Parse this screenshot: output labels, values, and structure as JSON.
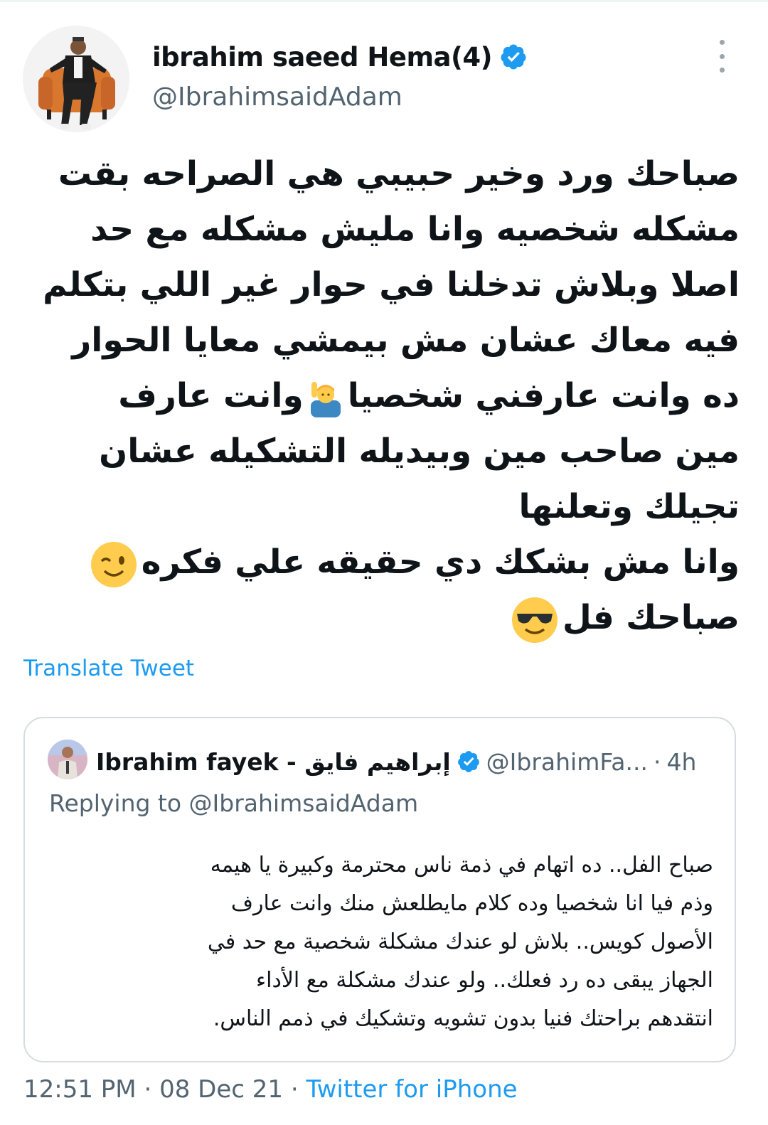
{
  "author": {
    "display_name": "ibrahim saeed Hema(4)",
    "handle": "@IbrahimsaidAdam",
    "verified": true,
    "avatar_icon": "user-avatar-photo"
  },
  "menu": {
    "icon": "more-vertical-icon"
  },
  "tweet": {
    "lines": [
      "صباحك ورد وخير حبيبي هي الصراحه بقت",
      "مشكله شخصيه وانا مليش مشكله مع حد",
      "اصلا وبلاش تدخلنا في حوار غير اللي بتكلم",
      "فيه معاك عشان مش بيمشي معايا الحوار",
      "ده وانت عارفني شخصيا",
      "وانت عارف",
      "مين صاحب مين وبيديله التشكيله عشان",
      "تجيلك وتعلنها",
      "وانا مش بشكك دي حقيقه علي فكره",
      "صباحك فل"
    ],
    "emojis": {
      "raising_hand": "man-raising-hand-emoji",
      "wink": "winking-face-emoji",
      "sunglasses": "smiling-face-with-sunglasses-emoji"
    }
  },
  "translate_label": "Translate Tweet",
  "quoted_tweet": {
    "display_name": "Ibrahim fayek - إبراهيم فايق",
    "handle": "@IbrahimFa...",
    "separator": "·",
    "time": "4h",
    "verified": true,
    "replying_label": "Replying to",
    "replying_to": "@IbrahimsaidAdam",
    "lines": [
      "صباح الفل.. ده اتهام في ذمة ناس محترمة وكبيرة يا هيمه",
      "وذم فيا انا شخصيا وده كلام مايطلعش منك وانت عارف",
      "الأصول كويس.. بلاش لو عندك مشكلة شخصية مع حد في",
      "الجهاز يبقى ده رد فعلك.. ولو عندك مشكلة مع الأداء",
      "انتقدهم براحتك فنيا بدون تشويه وتشكيك في ذمم الناس."
    ]
  },
  "footer": {
    "time": "12:51 PM",
    "sep1": "·",
    "date": "08 Dec 21",
    "sep2": "·",
    "source": "Twitter for iPhone"
  },
  "colors": {
    "accent": "#1d9bf0",
    "secondary_text": "#536471",
    "primary_text": "#0f1419",
    "border": "#d5dce0"
  }
}
